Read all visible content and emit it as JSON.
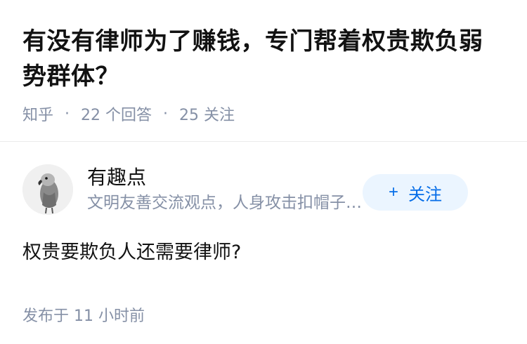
{
  "question": {
    "title": "有没有律师为了赚钱，专门帮着权贵欺负弱势群体？",
    "source": "知乎",
    "answers_count": "22 个回答",
    "followers_count": "25 关注"
  },
  "answer": {
    "author_name": "有趣点",
    "author_bio": "文明友善交流观点，人身攻击扣帽子等不文明行为必删",
    "follow_label": "关注",
    "follow_icon": "plus-icon",
    "content": "权贵要欺负人还需要律师?",
    "published": "发布于 11 小时前"
  },
  "colors": {
    "accent": "#056de8",
    "follow_bg": "#ebf5ff",
    "meta_gray": "#8590a6"
  }
}
